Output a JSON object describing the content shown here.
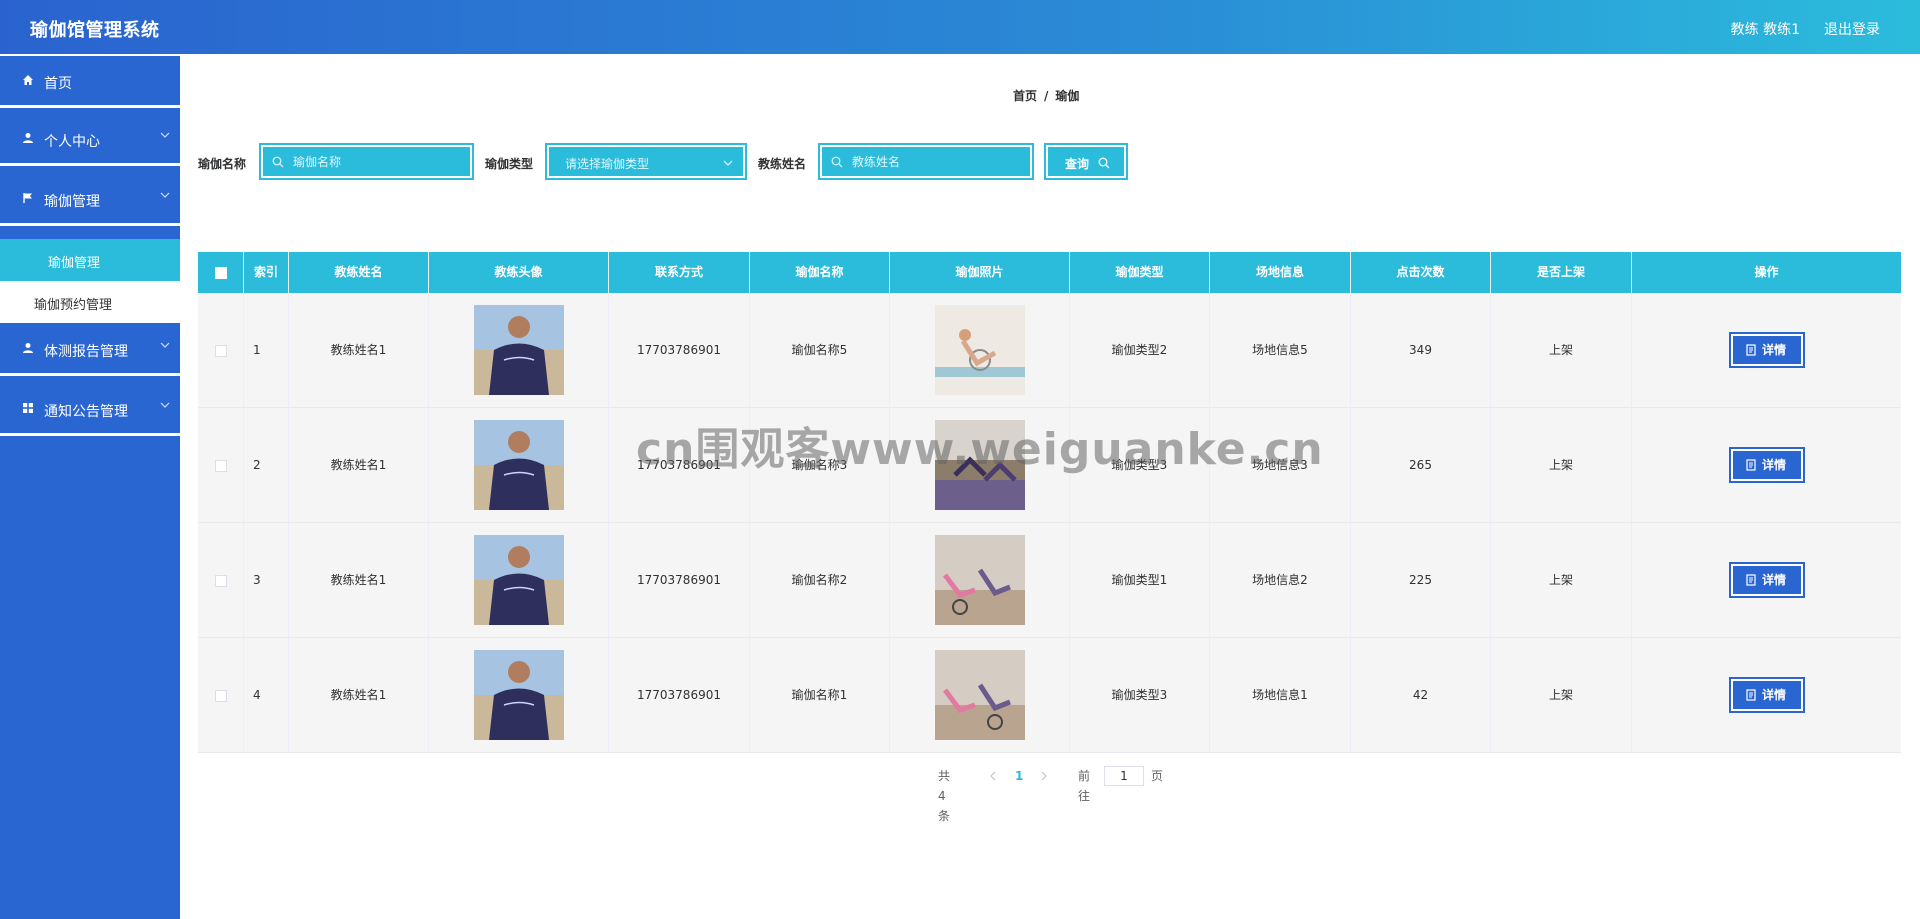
{
  "header": {
    "title": "瑜伽馆管理系统",
    "user": "教练 教练1",
    "logout": "退出登录",
    "gradient": [
      "#2a63cf",
      "#2bbcdc"
    ]
  },
  "sidebar": {
    "items": [
      {
        "label": "首页",
        "icon": "home-icon"
      },
      {
        "label": "个人中心",
        "icon": "user-icon"
      },
      {
        "label": "瑜伽管理",
        "icon": "flag-icon"
      },
      {
        "label": "体测报告管理",
        "icon": "user-icon"
      },
      {
        "label": "通知公告管理",
        "icon": "grid-icon"
      }
    ],
    "sub_items": [
      {
        "label": "瑜伽管理",
        "active": true
      },
      {
        "label": "瑜伽预约管理",
        "active": false
      }
    ],
    "color": "#2a66d2"
  },
  "breadcrumb": {
    "home": "首页",
    "separator": "/",
    "current": "瑜伽"
  },
  "search": {
    "name_label": "瑜伽名称",
    "name_placeholder": "瑜伽名称",
    "type_label": "瑜伽类型",
    "type_placeholder": "请选择瑜伽类型",
    "coach_label": "教练姓名",
    "coach_placeholder": "教练姓名",
    "query_label": "查询",
    "accent": "#2bbcdc"
  },
  "table": {
    "columns": [
      "索引",
      "教练姓名",
      "教练头像",
      "联系方式",
      "瑜伽名称",
      "瑜伽照片",
      "瑜伽类型",
      "场地信息",
      "点击次数",
      "是否上架",
      "操作"
    ],
    "rows": [
      {
        "index": "1",
        "coach": "教练姓名1",
        "phone": "17703786901",
        "name": "瑜伽名称5",
        "type": "瑜伽类型2",
        "venue": "场地信息5",
        "clicks": "349",
        "status": "上架",
        "action": "详情"
      },
      {
        "index": "2",
        "coach": "教练姓名1",
        "phone": "17703786901",
        "name": "瑜伽名称3",
        "type": "瑜伽类型3",
        "venue": "场地信息3",
        "clicks": "265",
        "status": "上架",
        "action": "详情"
      },
      {
        "index": "3",
        "coach": "教练姓名1",
        "phone": "17703786901",
        "name": "瑜伽名称2",
        "type": "瑜伽类型1",
        "venue": "场地信息2",
        "clicks": "225",
        "status": "上架",
        "action": "详情"
      },
      {
        "index": "4",
        "coach": "教练姓名1",
        "phone": "17703786901",
        "name": "瑜伽名称1",
        "type": "瑜伽类型3",
        "venue": "场地信息1",
        "clicks": "42",
        "status": "上架",
        "action": "详情"
      }
    ]
  },
  "pagination": {
    "total": "共 4 条",
    "current_page": "1",
    "goto_label": "前往",
    "goto_value": "1",
    "page_suffix": "页"
  },
  "watermark": "cn围观客www.weiguanke.cn"
}
